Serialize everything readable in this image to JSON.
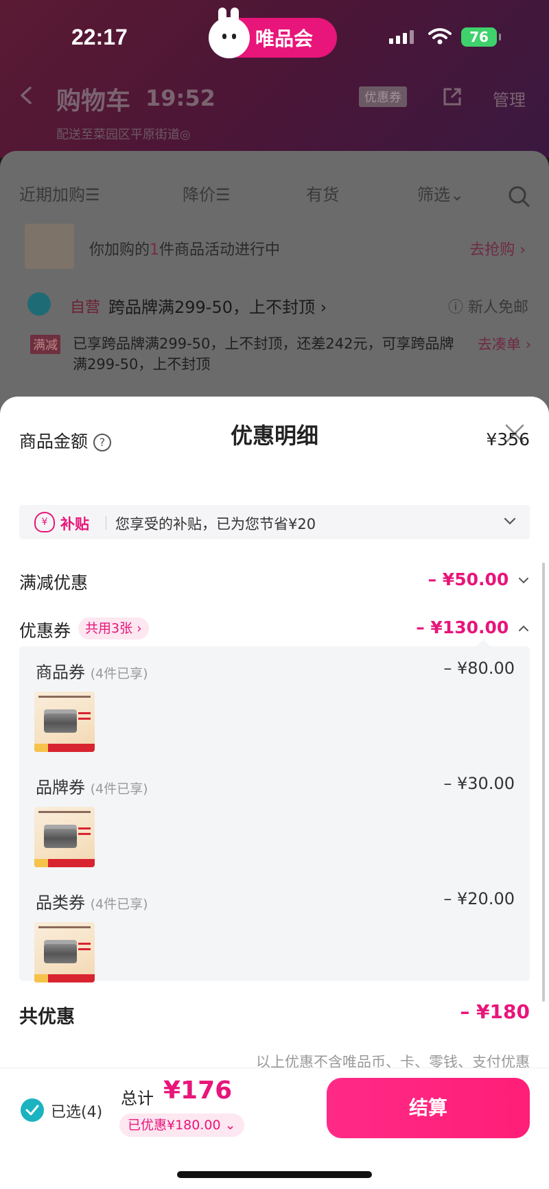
{
  "status": {
    "time": "22:17",
    "battery": "76"
  },
  "brand": {
    "name": "唯品会"
  },
  "bg": {
    "title": "购物车",
    "time": "19:52",
    "coupon_tag": "优惠券",
    "manage": "管理",
    "deliver": "配送至菜园区平原街道◎",
    "filters": [
      "近期加购☰",
      "降价☰",
      "有货",
      "筛选⌄"
    ],
    "promo_text_pre": "你加购的",
    "promo_count": "1",
    "promo_text_post": "件商品活动进行中",
    "promo_go": "去抢购 ›",
    "self_op": "自营",
    "store_name": "跨品牌满299-50，上不封顶 ›",
    "newbie": "ⓘ 新人免邮",
    "mj_tag": "满减",
    "mj_text": "已享跨品牌满299-50，上不封顶，还差242元，可享跨品牌满299-50，上不封顶",
    "mj_go": "去凑单 ›"
  },
  "sheet": {
    "title": "优惠明细",
    "goods_amount_label": "商品金额",
    "goods_amount": "¥356",
    "subsidy_label": "补贴",
    "subsidy_icon": "¥",
    "subsidy_text": "您享受的补贴，已为您节省¥20",
    "full_reduction_label": "满减优惠",
    "full_reduction_amount": "– ¥50.00",
    "coupon_label": "优惠券",
    "coupon_share": "共用3张 ›",
    "coupon_amount": "– ¥130.00",
    "coupon_groups": [
      {
        "name": "商品券",
        "note": "(4件已享)",
        "amount": "– ¥80.00"
      },
      {
        "name": "品牌券",
        "note": "(4件已享)",
        "amount": "– ¥30.00"
      },
      {
        "name": "品类券",
        "note": "(4件已享)",
        "amount": "– ¥20.00"
      }
    ],
    "total_discount_label": "共优惠",
    "total_discount_amount": "– ¥180",
    "note": "以上优惠不含唯品币、卡、零钱、支付优惠"
  },
  "bottom": {
    "selected": "已选(4)",
    "total_label": "总计",
    "total_value": "¥176",
    "saved": "已优惠¥180.00 ⌄",
    "checkout": "结算"
  },
  "colors": {
    "accent": "#e8157a",
    "teal": "#1bb3c0"
  }
}
